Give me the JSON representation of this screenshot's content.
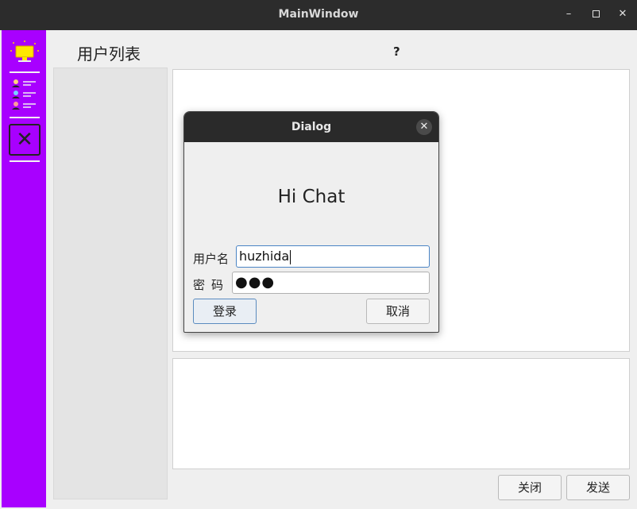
{
  "window": {
    "title": "MainWindow",
    "min_glyph": "–",
    "close_glyph": "✕"
  },
  "main": {
    "user_list_title": "用户列表",
    "help_label": "?",
    "close_label": "关闭",
    "send_label": "发送"
  },
  "sidebar": {
    "items": [
      {
        "icon": "monitor-icon"
      },
      {
        "icon": "user-list-icon"
      },
      {
        "icon": "close-x-icon",
        "glyph": "✕"
      }
    ],
    "accent": "#a800ff"
  },
  "dialog": {
    "title": "Dialog",
    "close_glyph": "✕",
    "heading": "Hi Chat",
    "username_label": "用户名",
    "username_value": "huzhida",
    "password_label": "密码",
    "password_mask": "●●●",
    "login_label": "登录",
    "cancel_label": "取消"
  }
}
